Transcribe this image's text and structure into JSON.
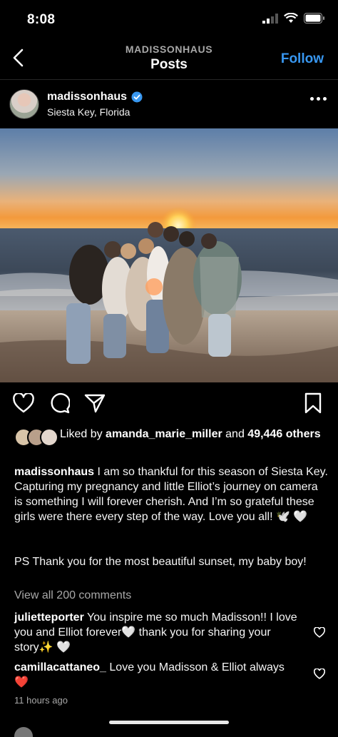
{
  "status_bar": {
    "time": "8:08"
  },
  "header": {
    "subtitle": "MADISSONHAUS",
    "title": "Posts",
    "follow_label": "Follow"
  },
  "post": {
    "username": "madissonhaus",
    "location": "Siesta Key, Florida",
    "verified": true,
    "likes": {
      "prefix": "Liked by ",
      "user": "amanda_marie_miller",
      "middle": " and ",
      "count": "49,446",
      "suffix": "others"
    },
    "caption": {
      "username": "madissonhaus",
      "text": " I am so thankful for this season of Siesta Key. Capturing my pregnancy and little Elliot’s journey on camera is something I will forever cherish. And I’m so grateful these girls were there every step of the way. Love you all! 🕊️ 🤍",
      "ps": "PS Thank you for the most beautiful sunset, my baby boy!"
    },
    "view_all_comments": "View all 200 comments",
    "comments": [
      {
        "username": "julietteporter",
        "text": " You inspire me so much Madisson!! I love you and Elliot forever🤍 thank you for sharing your story✨ 🤍"
      },
      {
        "username": "camillacattaneo_",
        "text": " Love you Madisson & Elliot always ❤️"
      }
    ],
    "time_ago": "11 hours ago"
  },
  "colors": {
    "accent": "#3897f0",
    "background": "#000000",
    "verified": "#3897f0"
  }
}
